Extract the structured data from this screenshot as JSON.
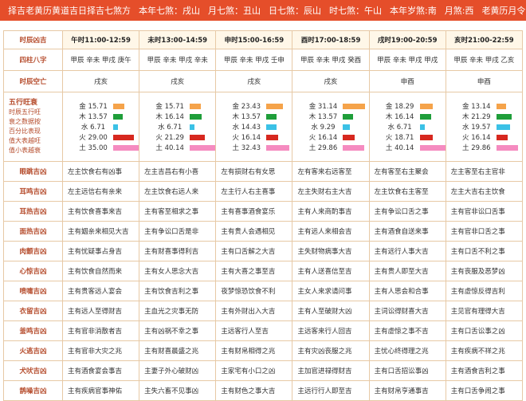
{
  "topbar": {
    "items": [
      "择吉老黄历黄道吉日择吉七煞方",
      "本年七煞：戌山",
      "月七煞：丑山",
      "日七煞：辰山",
      "时七煞：午山",
      "本年岁煞:南",
      "月煞:西",
      "老黄历月令:辛未"
    ]
  },
  "table": {
    "corner": "时辰凶吉",
    "headers": [
      "午时11:00-12:59",
      "未时13:00-14:59",
      "申时15:00-16:59",
      "酉时17:00-18:59",
      "戌时19:00-20:59",
      "亥时21:00-22:59"
    ],
    "bazi_label": "四柱八字",
    "bazi": [
      "甲辰 辛未 甲戌 庚午",
      "甲辰 辛未 甲戌 辛未",
      "甲辰 辛未 甲戌 壬申",
      "甲辰 辛未 甲戌 癸酉",
      "甲辰 辛未 甲戌 甲戌",
      "甲辰 辛未 甲戌 乙亥"
    ],
    "kongwang_label": "时辰空亡",
    "kongwang": [
      "戌亥",
      "戌亥",
      "戌亥",
      "戌亥",
      "申酉",
      "申酉"
    ],
    "wuxing_label": {
      "title": "五行旺衰",
      "lines": [
        "时辰五行旺",
        "衰之数据按",
        "百分比表现",
        "值大表越旺",
        "值小表越衰"
      ]
    },
    "element_colors": {
      "金": "#f5a34a",
      "木": "#1f9e3a",
      "水": "#3bc1e6",
      "火": "#d7281f",
      "土": "#f58bc0"
    },
    "wuxing": [
      [
        {
          "el": "金",
          "v": "15.71"
        },
        {
          "el": "木",
          "v": "13.57"
        },
        {
          "el": "水",
          "v": "6.71"
        },
        {
          "el": "火",
          "v": "29.00"
        },
        {
          "el": "土",
          "v": "35.00"
        }
      ],
      [
        {
          "el": "金",
          "v": "15.71"
        },
        {
          "el": "木",
          "v": "16.14"
        },
        {
          "el": "水",
          "v": "6.71"
        },
        {
          "el": "火",
          "v": "21.29"
        },
        {
          "el": "土",
          "v": "40.14"
        }
      ],
      [
        {
          "el": "金",
          "v": "23.43"
        },
        {
          "el": "木",
          "v": "13.57"
        },
        {
          "el": "水",
          "v": "14.43"
        },
        {
          "el": "火",
          "v": "16.14"
        },
        {
          "el": "土",
          "v": "32.43"
        }
      ],
      [
        {
          "el": "金",
          "v": "31.14"
        },
        {
          "el": "木",
          "v": "13.57"
        },
        {
          "el": "水",
          "v": "9.29"
        },
        {
          "el": "火",
          "v": "16.14"
        },
        {
          "el": "土",
          "v": "29.86"
        }
      ],
      [
        {
          "el": "金",
          "v": "18.29"
        },
        {
          "el": "木",
          "v": "16.14"
        },
        {
          "el": "水",
          "v": "6.71"
        },
        {
          "el": "火",
          "v": "18.71"
        },
        {
          "el": "土",
          "v": "40.14"
        }
      ],
      [
        {
          "el": "金",
          "v": "13.14"
        },
        {
          "el": "木",
          "v": "21.29"
        },
        {
          "el": "水",
          "v": "19.57"
        },
        {
          "el": "火",
          "v": "16.14"
        },
        {
          "el": "土",
          "v": "29.86"
        }
      ]
    ],
    "events": [
      {
        "label": "眼跳吉凶",
        "cells": [
          "左主饮食右有凶事",
          "左主吉昌右有小喜",
          "左有损财右有女思",
          "左有客来右远客至",
          "左有客至右主聚会",
          "左主客至右主官非"
        ]
      },
      {
        "label": "耳鸣吉凶",
        "cells": [
          "左主远信右有亲来",
          "左主饮食右远人来",
          "左主行人右主喜事",
          "左主失财右主大吉",
          "左主饮食右主客至",
          "左主大吉右主饮食"
        ]
      },
      {
        "label": "耳热吉凶",
        "cells": [
          "主有饮食喜事来吉",
          "主有客至相求之事",
          "主有喜事酒食宴乐",
          "主有人来商酌事吉",
          "主有争讼口舌之事",
          "主有官非讼口舌事"
        ]
      },
      {
        "label": "面热吉凶",
        "cells": [
          "主有姻亲来相见大吉",
          "主有争讼口舌是非",
          "主有贵人会遇相见",
          "主有远人来相会吉",
          "主有酒食自送来事",
          "主有官非口舌之事"
        ]
      },
      {
        "label": "肉颤吉凶",
        "cells": [
          "主有忧疑事占身吉",
          "主有财喜事得利吉",
          "主有口舌解之大吉",
          "主失财物病事大吉",
          "主有远行人事大吉",
          "主有口舌不利之事"
        ]
      },
      {
        "label": "心惊吉凶",
        "cells": [
          "主有饮食自然而来",
          "主有女人思念大吉",
          "主有大喜之事至吉",
          "主有人送喜信至吉",
          "主有贵人即至大吉",
          "主有丧服及恶梦凶"
        ]
      },
      {
        "label": "喷嚏吉凶",
        "cells": [
          "主有贵客远人宴会",
          "主有饮食吉利之事",
          "夜梦惊恐饮食不利",
          "主女人来求请问事",
          "主有人思会和合事",
          "主有虚惊反得吉利"
        ]
      },
      {
        "label": "衣留吉凶",
        "cells": [
          "主有远人至得财吉",
          "主血光之灾事无防",
          "主有外财出入大吉",
          "主有人至破财大凶",
          "主词讼得财喜大吉",
          "主见官有理得大吉"
        ]
      },
      {
        "label": "釜鸣吉凶",
        "cells": [
          "主有官非消散者吉",
          "主有凶祸不幸之事",
          "主远客行人至吉",
          "主远客来行人回吉",
          "主有虚惊之事不吉",
          "主有口舌讼事之凶"
        ]
      },
      {
        "label": "火逃吉凶",
        "cells": [
          "主有官非大灾之兆",
          "主有财喜晨盛之兆",
          "主有财帛相得之兆",
          "主有灾凶丧服之兆",
          "主忧心终得理之兆",
          "主有疾病不祥之兆"
        ]
      },
      {
        "label": "犬吠吉凶",
        "cells": [
          "主有酒食宴会事吉",
          "主妻子外心破财凶",
          "主家宅有小口之凶",
          "主加官进禄得财吉",
          "主有口舌招讼事凶",
          "主有酒食吉利之事"
        ]
      },
      {
        "label": "鹊噪吉凶",
        "cells": [
          "主有疾病官事神佑",
          "主失六畜不见事凶",
          "主有财色之事大吉",
          "主远行行人即至吉",
          "主有财帛亨通事吉",
          "主有口舌争闹之事"
        ]
      }
    ]
  }
}
